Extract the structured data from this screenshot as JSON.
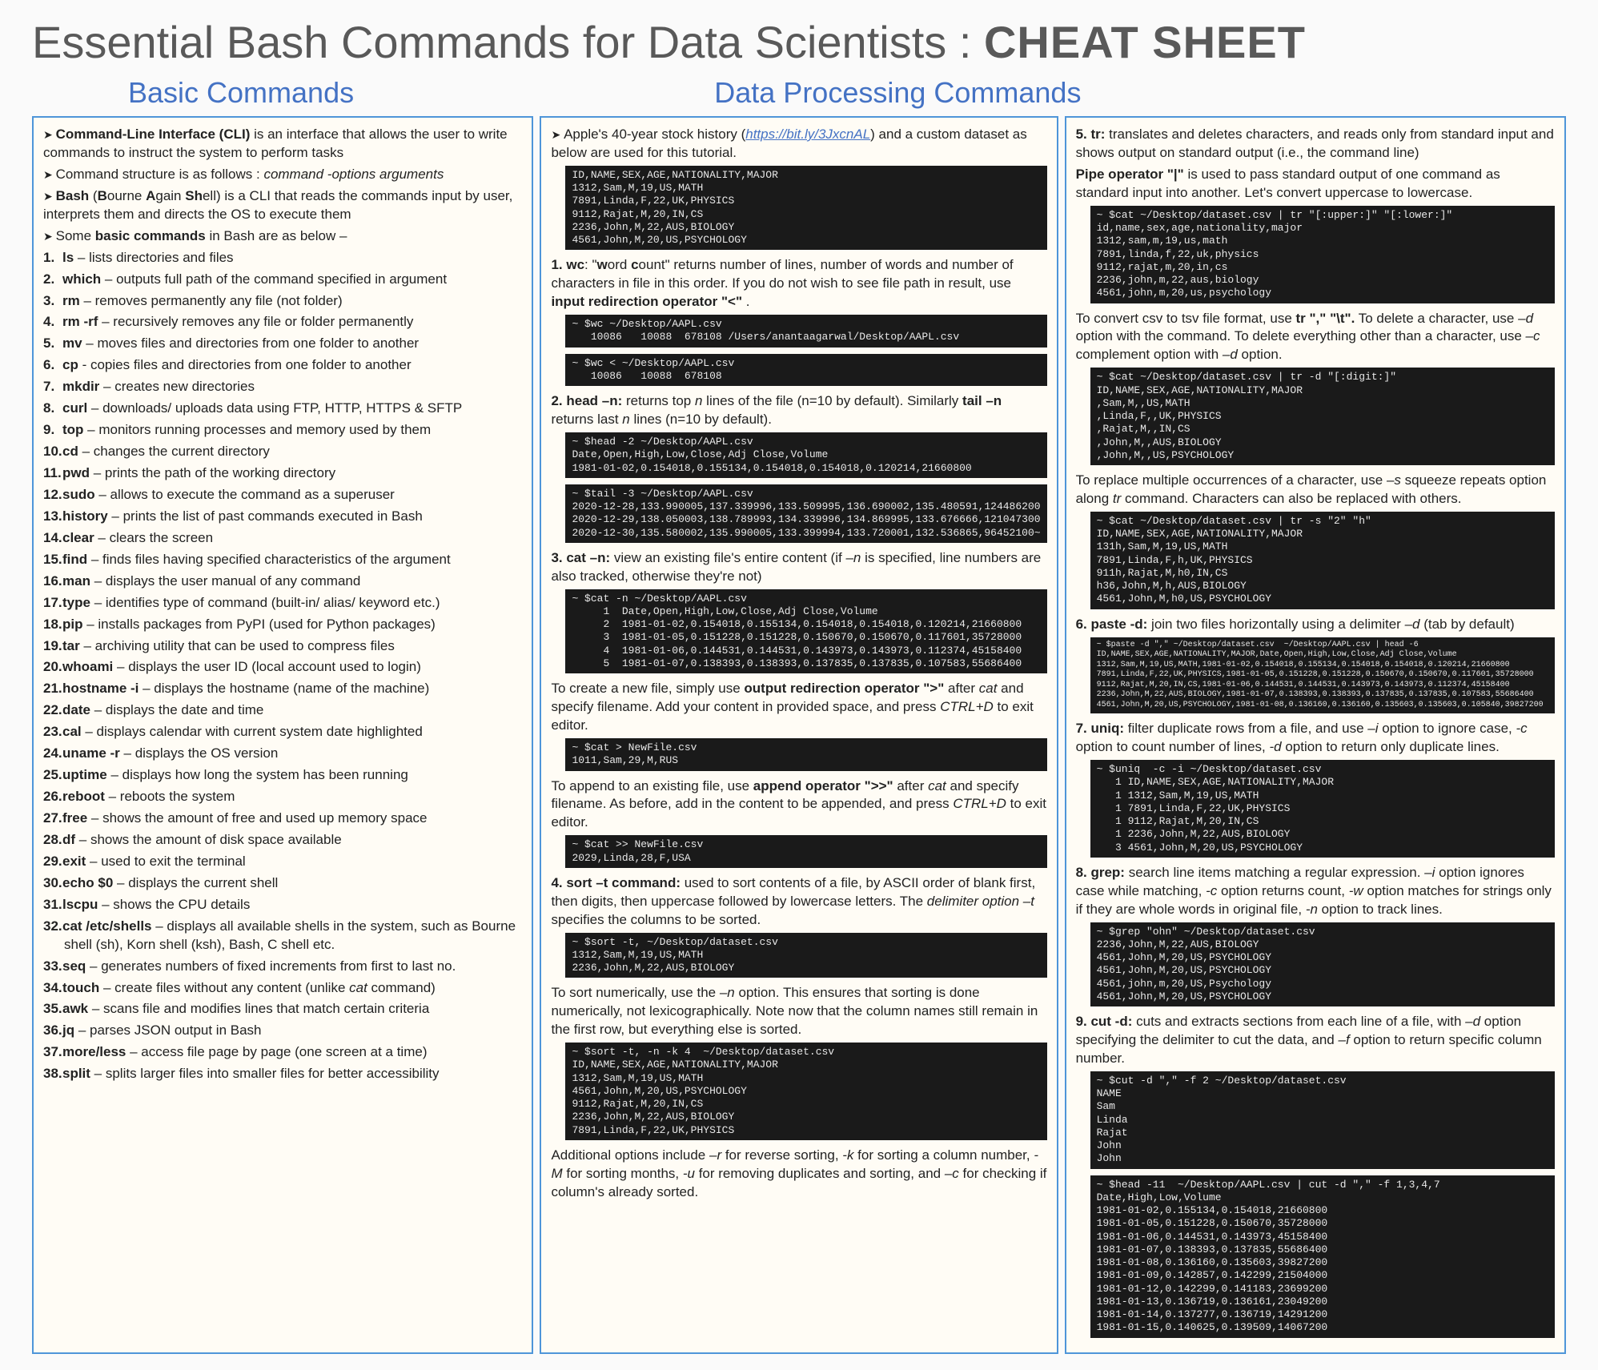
{
  "title": {
    "main": "Essential Bash Commands for Data Scientists",
    "sep": " : ",
    "cheat": "CHEAT SHEET"
  },
  "headers": {
    "basic": "Basic Commands",
    "data": "Data Processing Commands"
  },
  "col1": {
    "intro": [
      "<b>Command-Line Interface (CLI)</b> is an interface that allows the user to write commands to instruct the system to perform tasks",
      "Command structure is as follows : <i>command -options arguments</i>",
      "<b>Bash</b> (<b>B</b>ourne <b>A</b>gain <b>Sh</b>ell) is a CLI that reads the commands input by user, interprets them and directs the OS to execute them",
      "Some <b>basic commands</b> in Bash are as below –"
    ],
    "cmds": [
      "<b>ls</b>  – lists directories and files",
      "<b>which</b>  – outputs full path of the command specified in argument",
      "<b>rm</b> – removes permanently any file (not folder)",
      "<b>rm -rf</b> – recursively removes any file or folder permanently",
      "<b>mv</b> – moves files and directories from one folder to another",
      "<b>cp</b>  - copies files and directories from one folder to another",
      "<b>mkdir</b>  – creates new directories",
      "<b>curl</b>  – downloads/ uploads data using FTP, HTTP, HTTPS & SFTP",
      "<b>top</b>  – monitors running processes and memory used by them",
      "<b>cd</b> – changes the current directory",
      "<b>pwd</b> – prints the path of the working directory",
      "<b>sudo</b> – allows to execute the command as a superuser",
      "<b>history</b> – prints the list of past commands executed in Bash",
      "<b>clear</b> – clears the screen",
      "<b>find</b> – finds files having  specified characteristics of the argument",
      "<b>man</b> – displays the user manual of any command",
      "<b>type</b> – identifies type of command (built-in/ alias/ keyword etc.)",
      "<b>pip</b> – installs packages from PyPI (used for Python packages)",
      "<b>tar</b> – archiving utility that can be used to compress files",
      "<b>whoami</b> – displays the user ID (local account used to login)",
      "<b>hostname -i</b> – displays the hostname (name of the machine)",
      "<b>date</b> – displays the date and time",
      "<b>cal</b> – displays calendar with current system date highlighted",
      "<b>uname -r</b>  – displays the OS version",
      "<b>uptime</b> – displays how long the system has been running",
      "<b>reboot</b> – reboots the system",
      "<b>free</b> – shows the amount of free and used up memory space",
      "<b>df</b> – shows the amount of disk space available",
      "<b>exit</b> – used to exit the terminal",
      "<b>echo $0</b> – displays the current shell",
      "<b>lscpu</b> – shows the CPU details",
      "<b>cat /etc/shells</b> – displays all available shells in the system, such as Bourne shell (sh), Korn shell (ksh), Bash, C shell etc.",
      "<b>seq</b> – generates numbers of fixed increments from first to last no.",
      "<b>touch</b> – create files without any content (unlike <i>cat</i> command)",
      "<b>awk</b> – scans file and modifies lines that match certain criteria",
      "<b>jq</b> – parses JSON output in Bash",
      "<b>more/less</b> – access file page by page (one screen at a time)",
      "<b>split</b> – splits larger files into smaller files for better accessibility"
    ]
  },
  "col2": {
    "p_intro": "Apple's 40-year stock history (<span class='link'>https://bit.ly/3JxcnAL</span>) and a custom dataset as below are used for this tutorial.",
    "t_dataset": "ID,NAME,SEX,AGE,NATIONALITY,MAJOR\n1312,Sam,M,19,US,MATH\n7891,Linda,F,22,UK,PHYSICS\n9112,Rajat,M,20,IN,CS\n2236,John,M,22,AUS,BIOLOGY\n4561,John,M,20,US,PSYCHOLOGY",
    "p_wc": "<b>1. wc</b>: \"<b>w</b>ord <b>c</b>ount\" returns number of lines, number of words and number of characters in file in this order. If you do not wish to see file path in result, use <b>input redirection operator \"<\"</b> .",
    "t_wc1": "~ $wc ~/Desktop/AAPL.csv\n   10086   10088  678108 /Users/anantaagarwal/Desktop/AAPL.csv",
    "t_wc2": "~ $wc < ~/Desktop/AAPL.csv\n   10086   10088  678108",
    "p_head": "<b>2. head –n:</b> returns top <i>n</i> lines of the file (n=10 by default). Similarly <b>tail –n</b> returns last <i>n</i> lines (n=10 by default).",
    "t_head": "~ $head -2 ~/Desktop/AAPL.csv\nDate,Open,High,Low,Close,Adj Close,Volume\n1981-01-02,0.154018,0.155134,0.154018,0.154018,0.120214,21660800",
    "t_tail": "~ $tail -3 ~/Desktop/AAPL.csv\n2020-12-28,133.990005,137.339996,133.509995,136.690002,135.480591,124486200\n2020-12-29,138.050003,138.789993,134.339996,134.869995,133.676666,121047300\n2020-12-30,135.580002,135.990005,133.399994,133.720001,132.536865,96452100~",
    "p_cat": "<b>3. cat –n:</b> view an existing file's entire content (if <i>–n</i> is specified, line numbers are also tracked, otherwise they're not)",
    "t_cat": "~ $cat -n ~/Desktop/AAPL.csv\n     1  Date,Open,High,Low,Close,Adj Close,Volume\n     2  1981-01-02,0.154018,0.155134,0.154018,0.154018,0.120214,21660800\n     3  1981-01-05,0.151228,0.151228,0.150670,0.150670,0.117601,35728000\n     4  1981-01-06,0.144531,0.144531,0.143973,0.143973,0.112374,45158400\n     5  1981-01-07,0.138393,0.138393,0.137835,0.137835,0.107583,55686400",
    "p_redir": "To create a new file, simply use  <b>output redirection operator \">\"</b> after <i>cat</i> and specify filename. Add your content in provided space, and press <i>CTRL+D</i> to exit editor.",
    "t_redir": "~ $cat > NewFile.csv\n1011,Sam,29,M,RUS",
    "p_append": "To append to an existing file, use  <b>append operator \">>\"</b> after <i>cat</i> and specify filename. As before, add in the content to be appended, and press <i>CTRL+D</i> to exit editor.",
    "t_append": "~ $cat >> NewFile.csv\n2029,Linda,28,F,USA",
    "p_sort": "<b>4. sort –t command:</b> used to sort contents of a file, by ASCII order of blank first, then digits, then uppercase followed by lowercase letters. The <i>delimiter option –t</i> specifies the columns to be sorted.",
    "t_sort1": "~ $sort -t, ~/Desktop/dataset.csv\n1312,Sam,M,19,US,MATH\n2236,John,M,22,AUS,BIOLOGY",
    "p_sortn": "To sort numerically, use the <i>–n</i> option. This ensures that sorting is done numerically, not lexicographically. Note now that the column names still remain in the first row, but everything else is sorted.",
    "t_sort2": "~ $sort -t, -n -k 4  ~/Desktop/dataset.csv\nID,NAME,SEX,AGE,NATIONALITY,MAJOR\n1312,Sam,M,19,US,MATH\n4561,John,M,20,US,PSYCHOLOGY\n9112,Rajat,M,20,IN,CS\n2236,John,M,22,AUS,BIOLOGY\n7891,Linda,F,22,UK,PHYSICS",
    "p_sortopt": "Additional options include <i>–r</i> for reverse sorting, <i>-k</i> for sorting a column number, <i>-M</i> for sorting months, <i>-u</i> for removing duplicates and sorting, and <i>–c</i> for checking if column's already sorted."
  },
  "col3": {
    "p_tr": "<b>5. tr:</b> translates and deletes characters, and reads only from standard input and shows output on standard output (i.e., the command line)",
    "p_pipe": "<b>Pipe operator \"|\"</b> is used to pass standard output of one command as standard input into another. Let's convert uppercase to lowercase.",
    "t_pipe": "~ $cat ~/Desktop/dataset.csv | tr \"[:upper:]\" \"[:lower:]\"\nid,name,sex,age,nationality,major\n1312,sam,m,19,us,math\n7891,linda,f,22,uk,physics\n9112,rajat,m,20,in,cs\n2236,john,m,22,aus,biology\n4561,john,m,20,us,psychology",
    "p_trd": "To convert csv to tsv file format, use <b>tr \",\" \"\\t\".</b> To delete a character, use <i>–d</i> option with the command. To delete everything other than a character, use <i>–c</i> complement option with <i>–d</i> option.",
    "t_trd": "~ $cat ~/Desktop/dataset.csv | tr -d \"[:digit:]\"\nID,NAME,SEX,AGE,NATIONALITY,MAJOR\n,Sam,M,,US,MATH\n,Linda,F,,UK,PHYSICS\n,Rajat,M,,IN,CS\n,John,M,,AUS,BIOLOGY\n,John,M,,US,PSYCHOLOGY",
    "p_trs": "To replace multiple occurrences of a character, use <i>–s</i> squeeze repeats option along <i>tr</i> command. Characters can also be replaced with others.",
    "t_trs": "~ $cat ~/Desktop/dataset.csv | tr -s \"2\" \"h\"\nID,NAME,SEX,AGE,NATIONALITY,MAJOR\n131h,Sam,M,19,US,MATH\n7891,Linda,F,h,UK,PHYSICS\n911h,Rajat,M,h0,IN,CS\nh36,John,M,h,AUS,BIOLOGY\n4561,John,M,h0,US,PSYCHOLOGY",
    "p_paste": "<b>6. paste -d:</b> join two files horizontally using a delimiter <i>–d</i> (tab by default)",
    "t_paste": "~ $paste -d \",\" ~/Desktop/dataset.csv  ~/Desktop/AAPL.csv | head -6\nID,NAME,SEX,AGE,NATIONALITY,MAJOR,Date,Open,High,Low,Close,Adj Close,Volume\n1312,Sam,M,19,US,MATH,1981-01-02,0.154018,0.155134,0.154018,0.154018,0.120214,21660800\n7891,Linda,F,22,UK,PHYSICS,1981-01-05,0.151228,0.151228,0.150670,0.150670,0.117601,35728000\n9112,Rajat,M,20,IN,CS,1981-01-06,0.144531,0.144531,0.143973,0.143973,0.112374,45158400\n2236,John,M,22,AUS,BIOLOGY,1981-01-07,0.138393,0.138393,0.137835,0.137835,0.107583,55686400\n4561,John,M,20,US,PSYCHOLOGY,1981-01-08,0.136160,0.136160,0.135603,0.135603,0.105840,39827200",
    "p_uniq": "<b>7. uniq:</b> filter duplicate rows from a file, and use <i>–i</i> option to ignore case, <i>-c</i> option to count number of lines, <i>-d</i> option to return only duplicate lines.",
    "t_uniq": "~ $uniq  -c -i ~/Desktop/dataset.csv\n   1 ID,NAME,SEX,AGE,NATIONALITY,MAJOR\n   1 1312,Sam,M,19,US,MATH\n   1 7891,Linda,F,22,UK,PHYSICS\n   1 9112,Rajat,M,20,IN,CS\n   1 2236,John,M,22,AUS,BIOLOGY\n   3 4561,John,M,20,US,PSYCHOLOGY",
    "p_grep": "<b>8. grep:</b> search line items matching a regular expression. <i>–i</i> option ignores case while matching, <i>-c</i> option returns count, <i>-w</i> option matches for strings only if they are whole words in original file, <i>-n</i> option to track lines.",
    "t_grep": "~ $grep \"ohn\" ~/Desktop/dataset.csv\n2236,John,M,22,AUS,BIOLOGY\n4561,John,M,20,US,PSYCHOLOGY\n4561,John,M,20,US,PSYCHOLOGY\n4561,john,m,20,US,Psychology\n4561,John,M,20,US,PSYCHOLOGY",
    "p_cut": "<b>9. cut -d:</b> cuts and extracts sections from each line of a file, with <i>–d</i> option specifying the delimiter to cut the data, and <i>–f</i> option to return specific column number.",
    "t_cut1": "~ $cut -d \",\" -f 2 ~/Desktop/dataset.csv\nNAME\nSam\nLinda\nRajat\nJohn\nJohn",
    "t_cut2": "~ $head -11  ~/Desktop/AAPL.csv | cut -d \",\" -f 1,3,4,7\nDate,High,Low,Volume\n1981-01-02,0.155134,0.154018,21660800\n1981-01-05,0.151228,0.150670,35728000\n1981-01-06,0.144531,0.143973,45158400\n1981-01-07,0.138393,0.137835,55686400\n1981-01-08,0.136160,0.135603,39827200\n1981-01-09,0.142857,0.142299,21504000\n1981-01-12,0.142299,0.141183,23699200\n1981-01-13,0.136719,0.136161,23049200\n1981-01-14,0.137277,0.136719,14291200\n1981-01-15,0.140625,0.139509,14067200"
  }
}
